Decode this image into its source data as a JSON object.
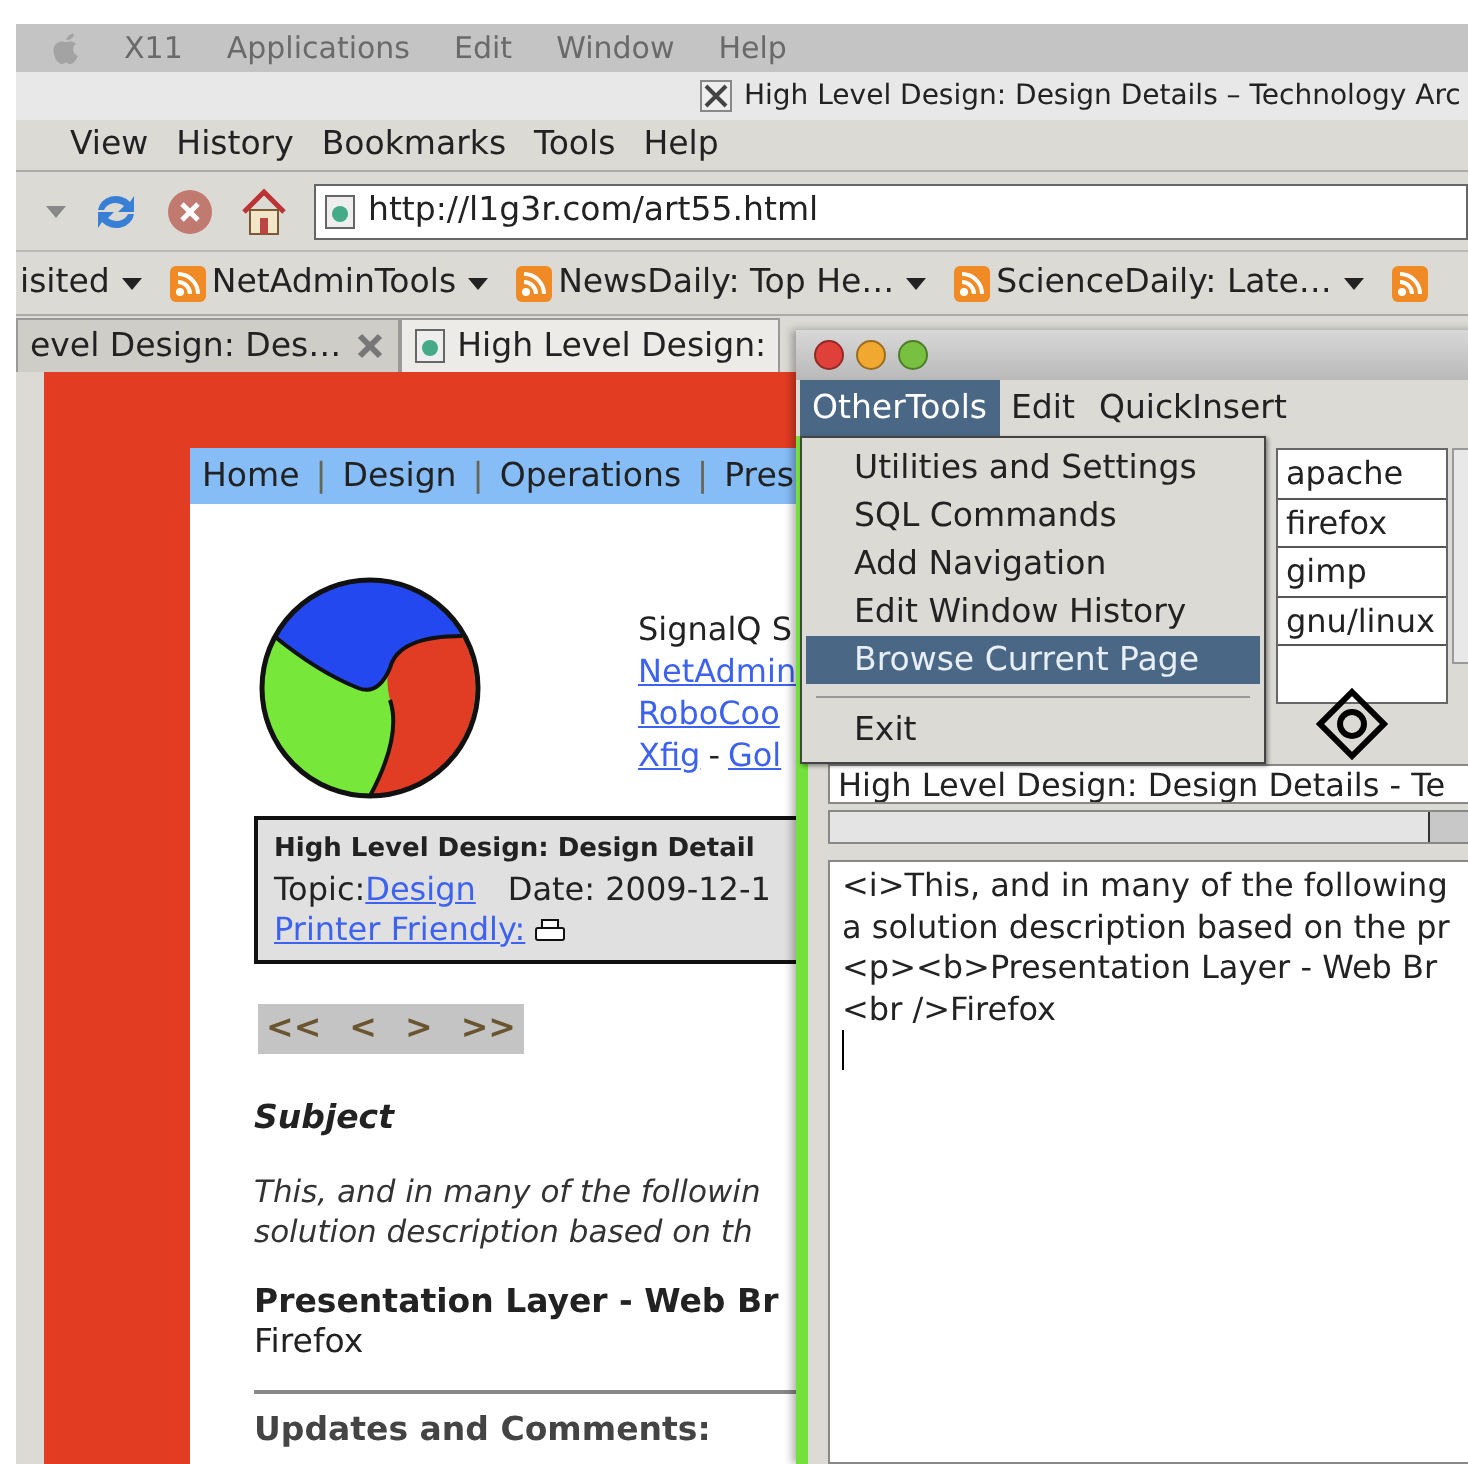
{
  "mac_menubar": {
    "items": [
      "X11",
      "Applications",
      "Edit",
      "Window",
      "Help"
    ]
  },
  "browser": {
    "title": "High Level Design: Design Details – Technology Arc",
    "menu": [
      "View",
      "History",
      "Bookmarks",
      "Tools",
      "Help"
    ],
    "url": "http://l1g3r.com/art55.html",
    "bookmarks": [
      {
        "label": "isited",
        "feed": false
      },
      {
        "label": "NetAdminTools",
        "feed": true
      },
      {
        "label": "NewsDaily: Top He…",
        "feed": true
      },
      {
        "label": "ScienceDaily: Late…",
        "feed": true
      }
    ],
    "tabs": [
      {
        "label": "evel Design: Des…",
        "selected": false
      },
      {
        "label": "High Level Design:",
        "selected": true
      }
    ]
  },
  "page": {
    "nav": [
      {
        "text": "Home",
        "kind": "link"
      },
      {
        "text": "|",
        "kind": "divider"
      },
      {
        "text": "Design",
        "kind": "link"
      },
      {
        "text": "|",
        "kind": "divider"
      },
      {
        "text": "Operations",
        "kind": "link"
      },
      {
        "text": "|",
        "kind": "divider"
      },
      {
        "text": "Pres",
        "kind": "link"
      }
    ],
    "site": "SignalQ S",
    "link_lines": [
      [
        {
          "text": "NetAdmin",
          "link": true
        }
      ],
      [
        {
          "text": "RoboCoo",
          "link": true
        }
      ],
      [
        {
          "text": "Xfig",
          "link": true
        },
        {
          "text": "-",
          "link": false
        },
        {
          "text": "Gol",
          "link": true
        }
      ]
    ],
    "info": {
      "title": "High Level Design: Design Detail",
      "topic_label": "Topic:",
      "topic": "Design",
      "date": "Date: 2009-12-1",
      "printer": "Printer Friendly:"
    },
    "pager": [
      "<<",
      "<",
      ">",
      ">>"
    ],
    "subject": "Subject",
    "intro_lines": [
      "This, and in many of the followin",
      "solution description based on th"
    ],
    "section_title": "Presentation Layer - Web Br",
    "section_text": "Firefox",
    "comments_title": "Updates and Comments:"
  },
  "editor_window": {
    "menu": [
      {
        "label": "OtherTools",
        "selected": true
      },
      {
        "label": "Edit",
        "selected": false
      },
      {
        "label": "QuickInsert",
        "selected": false
      }
    ],
    "dropdown": [
      {
        "label": "Utilities and Settings",
        "selected": false,
        "separator_before": false
      },
      {
        "label": "SQL Commands",
        "selected": false,
        "separator_before": false
      },
      {
        "label": "Add Navigation",
        "selected": false,
        "separator_before": false
      },
      {
        "label": "Edit Window History",
        "selected": false,
        "separator_before": false
      },
      {
        "label": "Browse Current Page",
        "selected": true,
        "separator_before": false
      },
      {
        "label": "Exit",
        "selected": false,
        "separator_before": true
      }
    ],
    "tags": [
      "apache",
      "firefox",
      "gimp",
      "gnu/linux"
    ],
    "title_field": "High Level Design: Design Details - Te",
    "editor_lines": [
      "<i>This, and in many of the following",
      "a solution description based on the pr",
      "<p><b>Presentation Layer - Web Br",
      "<br />Firefox"
    ]
  }
}
